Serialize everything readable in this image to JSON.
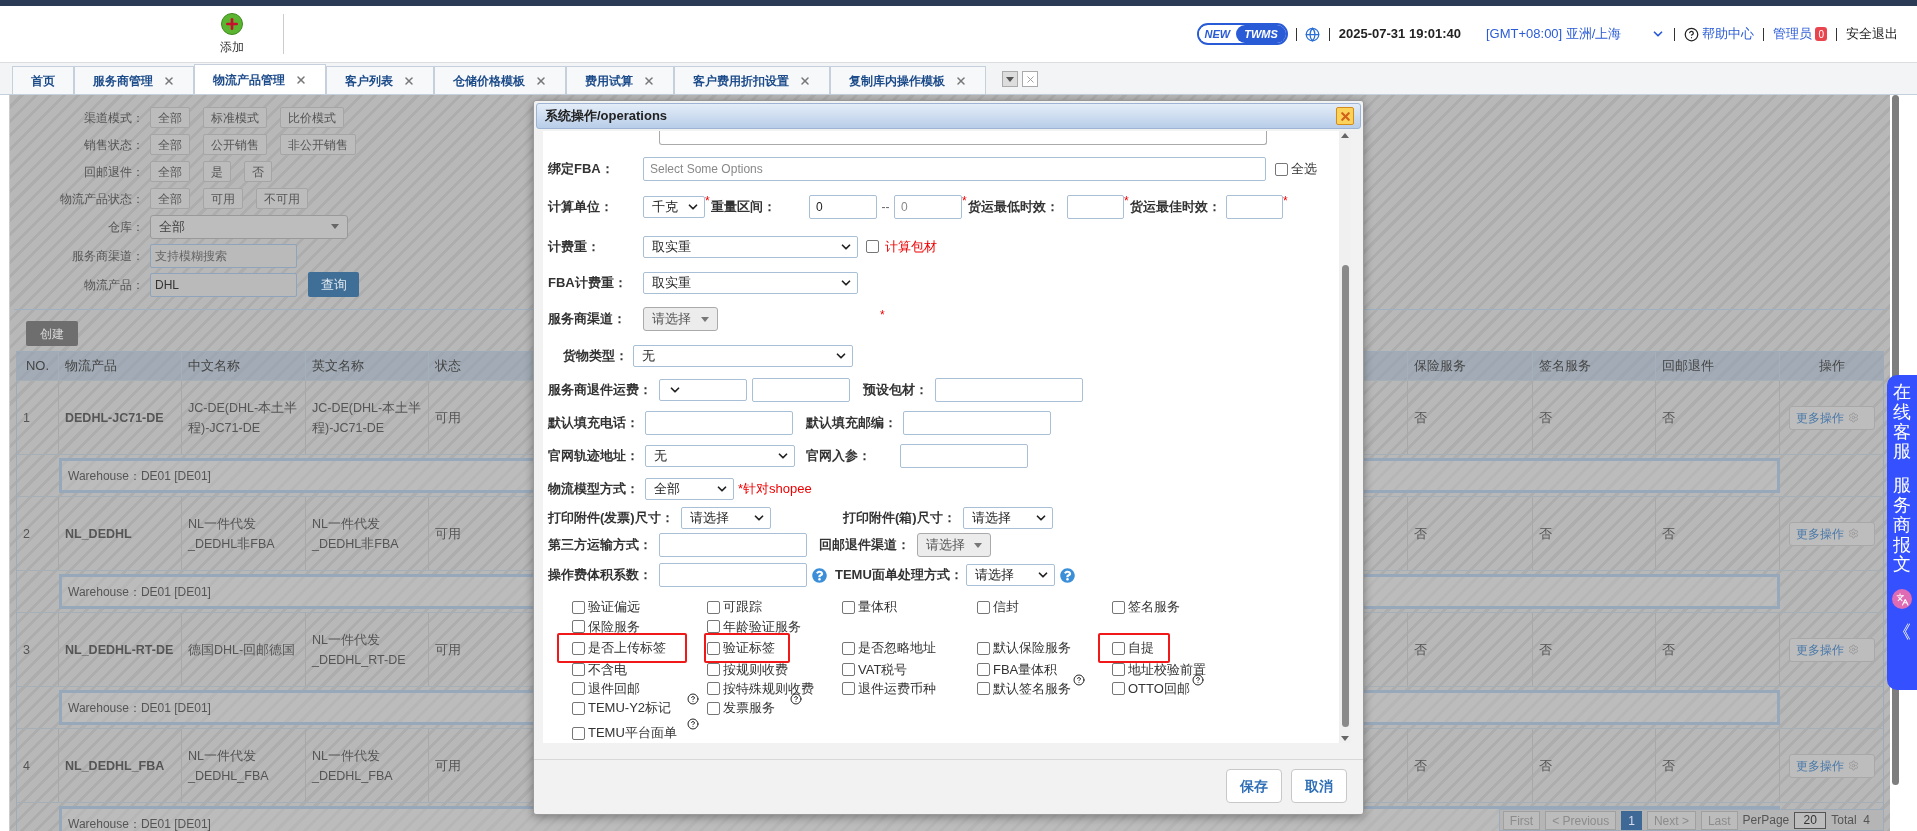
{
  "header": {
    "add_button": "添加",
    "badge": {
      "new": "NEW",
      "name": "TWMS"
    },
    "datetime": "2025-07-31 19:01:40",
    "timezone": "[GMT+08:00] 亚洲/上海",
    "help": "帮助中心",
    "user": "管理员",
    "notification_count": "0",
    "logout": "安全退出"
  },
  "tabs": [
    {
      "label": "首页",
      "closable": false,
      "selected": false
    },
    {
      "label": "服务商管理",
      "closable": true,
      "selected": false
    },
    {
      "label": "物流产品管理",
      "closable": true,
      "selected": true
    },
    {
      "label": "客户列表",
      "closable": true,
      "selected": false
    },
    {
      "label": "仓储价格模板",
      "closable": true,
      "selected": false
    },
    {
      "label": "费用试算",
      "closable": true,
      "selected": false
    },
    {
      "label": "客户费用折扣设置",
      "closable": true,
      "selected": false
    },
    {
      "label": "复制库内操作模板",
      "closable": true,
      "selected": false
    }
  ],
  "filters": [
    {
      "kind": "options",
      "label": "渠道模式：",
      "options": [
        "全部",
        "标准模式",
        "比价模式"
      ]
    },
    {
      "kind": "options",
      "label": "销售状态：",
      "options": [
        "全部",
        "公开销售",
        "非公开销售"
      ]
    },
    {
      "kind": "options",
      "label": "回邮退件：",
      "options": [
        "全部",
        "是",
        "否"
      ]
    },
    {
      "kind": "options",
      "label": "物流产品状态：",
      "options": [
        "全部",
        "可用",
        "不可用"
      ]
    },
    {
      "kind": "select",
      "label": "仓库：",
      "value": "全部"
    },
    {
      "kind": "input",
      "label": "服务商渠道：",
      "placeholder": "支持模糊搜索"
    },
    {
      "kind": "input",
      "label": "物流产品：",
      "value": "DHL",
      "button": "查询"
    }
  ],
  "create_button": "创建",
  "table": {
    "columns": [
      "NO.",
      "物流产品",
      "中文名称",
      "英文名称",
      "状态",
      "保险服务",
      "签名服务",
      "回邮退件",
      "操作"
    ],
    "rows": [
      {
        "no": "1",
        "product": "DEDHL-JC71-DE",
        "cn_name": "JC-DE(DHL-本土半程)-JC71-DE",
        "en_name": "JC-DE(DHL-本土半程)-JC71-DE",
        "status": "可用",
        "insurance": "否",
        "signature": "否",
        "return": "否",
        "action": "更多操作",
        "warehouse": "Warehouse：DE01 [DE01]"
      },
      {
        "no": "2",
        "product": "NL_DEDHL",
        "cn_name": "NL一件代发_DEDHL非FBA",
        "en_name": "NL一件代发_DEDHL非FBA",
        "status": "可用",
        "insurance": "否",
        "signature": "否",
        "return": "否",
        "action": "更多操作",
        "warehouse": "Warehouse：DE01 [DE01]"
      },
      {
        "no": "3",
        "product": "NL_DEDHL-RT-DE",
        "cn_name": "德国DHL-回邮德国",
        "en_name": "NL一件代发_DEDHL_RT-DE",
        "status": "可用",
        "insurance": "否",
        "signature": "否",
        "return": "否",
        "action": "更多操作",
        "warehouse": "Warehouse：DE01 [DE01]"
      },
      {
        "no": "4",
        "product": "NL_DEDHL_FBA",
        "cn_name": "NL一件代发_DEDHL_FBA",
        "en_name": "NL一件代发_DEDHL_FBA",
        "status": "可用",
        "insurance": "否",
        "signature": "否",
        "return": "否",
        "action": "更多操作",
        "warehouse": "Warehouse：DE01 [DE01]"
      }
    ]
  },
  "pagination": {
    "before": [
      {
        "label": "First",
        "disabled": true
      },
      {
        "label": "< Previous",
        "disabled": true
      }
    ],
    "pages": [
      {
        "label": "1",
        "selected": true
      }
    ],
    "after": [
      {
        "label": "Next >",
        "disabled": true
      },
      {
        "label": "Last",
        "disabled": true
      }
    ],
    "per_page_label": "PerPage",
    "per_page": "20",
    "total": "Total  4"
  },
  "dialog": {
    "title": "系统操作/operations",
    "form_rows": [
      [
        {
          "kind": "input"
        }
      ],
      [
        {
          "kind": "label",
          "text": "绑定FBA："
        },
        {
          "kind": "input",
          "placeholder": "Select Some Options"
        },
        {
          "kind": "checkbox",
          "text": "全选",
          "checked": false
        }
      ],
      [
        {
          "kind": "label",
          "text": "计算单位："
        },
        {
          "kind": "select",
          "value": "千克"
        },
        {
          "kind": "star",
          "text": "*"
        },
        {
          "kind": "label",
          "text": "重量区间："
        },
        {
          "kind": "input",
          "value": "0"
        },
        {
          "kind": "text",
          "text": "--"
        },
        {
          "kind": "input",
          "placeholder": "0"
        },
        {
          "kind": "star",
          "text": "*"
        },
        {
          "kind": "label",
          "text": "货运最低时效："
        },
        {
          "kind": "input"
        },
        {
          "kind": "star",
          "text": "*"
        },
        {
          "kind": "label",
          "text": "货运最佳时效："
        },
        {
          "kind": "input"
        },
        {
          "kind": "star",
          "text": "*"
        }
      ],
      [
        {
          "kind": "label",
          "text": "计费重："
        },
        {
          "kind": "select",
          "value": "取实重"
        },
        {
          "kind": "checkbox",
          "checked": false
        },
        {
          "kind": "note",
          "text": "计算包材"
        }
      ],
      [
        {
          "kind": "label",
          "text": "FBA计费重："
        },
        {
          "kind": "select",
          "value": "取实重"
        }
      ],
      [
        {
          "kind": "label",
          "text": "服务商渠道："
        },
        {
          "kind": "dropdown",
          "value": "请选择"
        },
        {
          "kind": "star",
          "text": "*"
        }
      ],
      [
        {
          "kind": "label",
          "text": "货物类型："
        },
        {
          "kind": "select",
          "value": "无"
        }
      ],
      [
        {
          "kind": "label",
          "text": "服务商退件运费："
        },
        {
          "kind": "select"
        },
        {
          "kind": "input"
        },
        {
          "kind": "label",
          "text": "预设包材："
        },
        {
          "kind": "input"
        }
      ],
      [
        {
          "kind": "label",
          "text": "默认填充电话："
        },
        {
          "kind": "input"
        },
        {
          "kind": "label",
          "text": "默认填充邮编："
        },
        {
          "kind": "input"
        }
      ],
      [
        {
          "kind": "label",
          "text": "官网轨迹地址："
        },
        {
          "kind": "select",
          "value": "无"
        },
        {
          "kind": "label",
          "text": "官网入参："
        },
        {
          "kind": "input"
        }
      ],
      [
        {
          "kind": "label",
          "text": "物流模型方式："
        },
        {
          "kind": "select",
          "value": "全部"
        },
        {
          "kind": "note",
          "text": "*针对shopee"
        }
      ],
      [
        {
          "kind": "label",
          "text": "打印附件(发票)尺寸："
        },
        {
          "kind": "select",
          "value": "请选择"
        },
        {
          "kind": "label",
          "text": "打印附件(箱)尺寸："
        },
        {
          "kind": "select",
          "value": "请选择"
        }
      ],
      [
        {
          "kind": "label",
          "text": "第三方运输方式："
        },
        {
          "kind": "input"
        },
        {
          "kind": "label",
          "text": "回邮退件渠道："
        },
        {
          "kind": "dropdown",
          "value": "请选择"
        }
      ],
      [
        {
          "kind": "label",
          "text": "操作费体积系数："
        },
        {
          "kind": "input"
        },
        {
          "kind": "help"
        },
        {
          "kind": "label",
          "text": "TEMU面单处理方式："
        },
        {
          "kind": "select",
          "value": "请选择"
        },
        {
          "kind": "help"
        }
      ]
    ],
    "options": [
      [
        {
          "text": "验证偏远",
          "checked": false,
          "highlighted": false,
          "help": false
        },
        {
          "text": "可跟踪",
          "checked": false,
          "highlighted": false,
          "help": false
        },
        {
          "text": "量体积",
          "checked": false,
          "highlighted": false,
          "help": false
        },
        {
          "text": "信封",
          "checked": false,
          "highlighted": false,
          "help": false
        },
        {
          "text": "签名服务",
          "checked": false,
          "highlighted": false,
          "help": false
        }
      ],
      [
        {
          "text": "保险服务",
          "checked": false,
          "highlighted": false,
          "help": false
        },
        {
          "text": "年龄验证服务",
          "checked": false,
          "highlighted": false,
          "help": false
        }
      ],
      [
        {
          "text": "是否上传标签",
          "checked": false,
          "highlighted": true,
          "help": false
        },
        {
          "text": "验证标签",
          "checked": false,
          "highlighted": true,
          "help": false
        },
        {
          "text": "是否忽略地址",
          "checked": false,
          "highlighted": false,
          "help": false
        },
        {
          "text": "默认保险服务",
          "checked": false,
          "highlighted": false,
          "help": false
        },
        {
          "text": "自提",
          "checked": false,
          "highlighted": true,
          "help": false
        }
      ],
      [
        {
          "text": "不含电",
          "checked": false,
          "highlighted": false,
          "help": false
        },
        {
          "text": "按规则收费",
          "checked": false,
          "highlighted": false,
          "help": false
        },
        {
          "text": "VAT税号",
          "checked": false,
          "highlighted": false,
          "help": false
        },
        {
          "text": "FBA量体积",
          "checked": false,
          "highlighted": false,
          "help": false
        },
        {
          "text": "地址校验前置",
          "checked": false,
          "highlighted": false,
          "help": false
        }
      ],
      [
        {
          "text": "退件回邮",
          "checked": false,
          "highlighted": false,
          "help": false
        },
        {
          "text": "按特殊规则收费",
          "checked": false,
          "highlighted": false,
          "help": false
        },
        {
          "text": "退件运费币种",
          "checked": false,
          "highlighted": false,
          "help": false
        },
        {
          "text": "默认签名服务",
          "checked": false,
          "highlighted": false,
          "help": true
        },
        {
          "text": "OTTO回邮",
          "checked": false,
          "highlighted": false,
          "help": true
        }
      ],
      [
        {
          "text": "TEMU-Y2标记",
          "checked": false,
          "highlighted": false,
          "help": true
        },
        {
          "text": "发票服务",
          "checked": false,
          "highlighted": false,
          "help": true
        }
      ],
      [
        {
          "text": "TEMU平台面单",
          "checked": false,
          "highlighted": false,
          "help": true
        }
      ]
    ],
    "buttons": [
      "保存",
      "取消"
    ]
  },
  "side_widget": {
    "labels": [
      "在线客服",
      "服务商报文"
    ],
    "collapse": "《"
  }
}
